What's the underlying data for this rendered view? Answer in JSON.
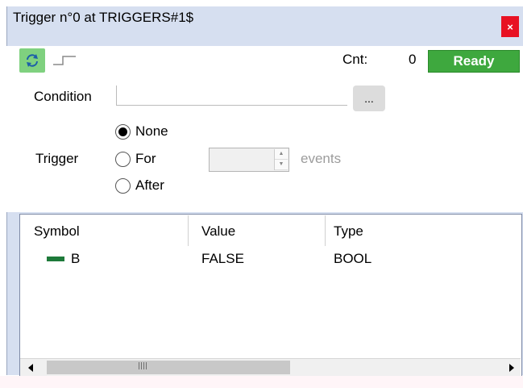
{
  "window": {
    "title": "Trigger n°0 at TRIGGERS#1$",
    "close_label": "×"
  },
  "toolbar": {
    "refresh_icon": "refresh-icon",
    "step_icon": "step-signal-icon",
    "cnt_label": "Cnt:",
    "cnt_value": "0",
    "status": "Ready"
  },
  "condition": {
    "label": "Condition",
    "value": "",
    "browse_label": "..."
  },
  "trigger": {
    "label": "Trigger",
    "options": [
      "None",
      "For",
      "After"
    ],
    "selected": "None",
    "count_value": "",
    "events_label": "events"
  },
  "table": {
    "columns": [
      "Symbol",
      "Value",
      "Type"
    ],
    "rows": [
      {
        "symbol": "B",
        "value": "FALSE",
        "type": "BOOL",
        "color": "#1e7a3a"
      }
    ]
  },
  "colors": {
    "ready": "#3ea83e",
    "refresh": "#7fd17f",
    "close": "#e81123",
    "titlebar": "#d6dff0"
  }
}
